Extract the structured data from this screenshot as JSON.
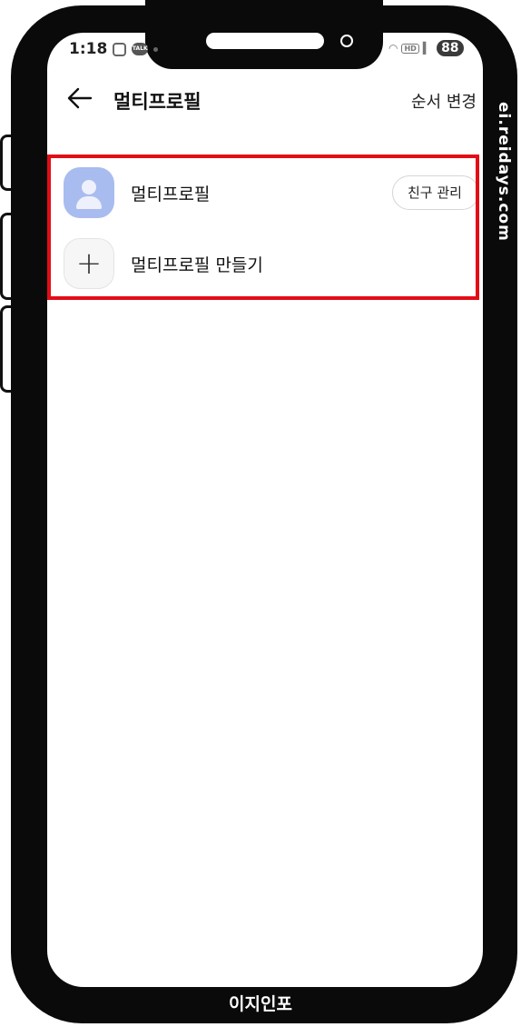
{
  "status_bar": {
    "time": "1:18",
    "battery": "88",
    "icons": [
      "screenshot-icon",
      "kakaotalk-icon",
      "dot-icon",
      "wifi-icon",
      "hd-icon",
      "signal-icon"
    ]
  },
  "header": {
    "title": "멀티프로필",
    "reorder_label": "순서 변경"
  },
  "profiles": {
    "items": [
      {
        "label": "멀티프로필",
        "action_label": "친구 관리"
      }
    ],
    "create_label": "멀티프로필 만들기"
  },
  "overlay": {
    "watermark": "ei.reidays.com",
    "brand": "이지인포",
    "highlight_color": "#e30d16"
  }
}
